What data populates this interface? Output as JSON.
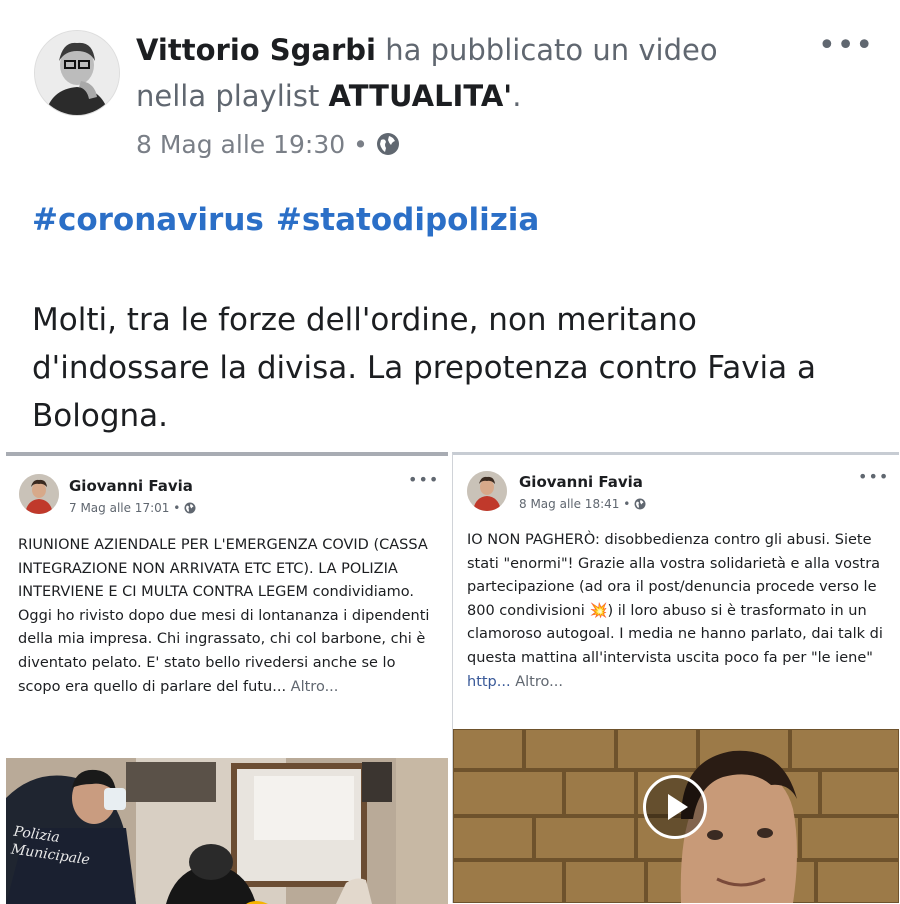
{
  "main_post": {
    "author": "Vittorio Sgarbi",
    "action_text": "ha pubblicato un video",
    "playlist_prefix": "nella playlist",
    "playlist_name": "ATTUALITA'",
    "playlist_suffix": ".",
    "timestamp": "8 Mag alle 19:30",
    "separator": "•",
    "privacy_icon": "globe-icon",
    "more_label": "•••",
    "hashtags": [
      "#coronavirus",
      "#statodipolizia"
    ],
    "text": "Molti, tra le forze dell'ordine, non meritano d'indossare la divisa. La prepotenza contro Favia a Bologna."
  },
  "left_post": {
    "author": "Giovanni Favia",
    "timestamp": "7 Mag alle 17:01",
    "separator": "•",
    "privacy_icon": "globe-icon",
    "more_label": "•••",
    "text": "RIUNIONE AZIENDALE PER L'EMERGENZA COVID (CASSA INTEGRAZIONE NON ARRIVATA ETC ETC). LA POLIZIA INTERVIENE E CI MULTA CONTRA LEGEM condividiamo.\nOggi ho rivisto dopo due mesi di lontananza i dipendenti della mia impresa. Chi ingrassato, chi col barbone, chi è diventato pelato. E' stato bello rivedersi anche se lo scopo era quello di parlare del futu...",
    "more_link": "Altro...",
    "badge_text": "Polizia\nMunicipale"
  },
  "right_post": {
    "author": "Giovanni Favia",
    "timestamp": "8 Mag alle 18:41",
    "separator": "•",
    "privacy_icon": "globe-icon",
    "more_label": "•••",
    "text": "IO NON PAGHERÒ: disobbedienza contro gli abusi. Siete stati \"enormi\"! Grazie alla vostra solidarietà e alla vostra partecipazione (ad ora il post/denuncia procede verso le 800 condivisioni 💥) il loro abuso si è trasformato in un clamoroso autogoal. I media ne hanno parlato, dai talk di questa mattina all'intervista uscita poco fa per \"le iene\" ",
    "url_text": "http...",
    "more_link": "Altro...",
    "play_icon": "play-icon"
  },
  "colors": {
    "hashtag": "#2b6fc7",
    "link": "#385898",
    "meta": "#606770"
  }
}
